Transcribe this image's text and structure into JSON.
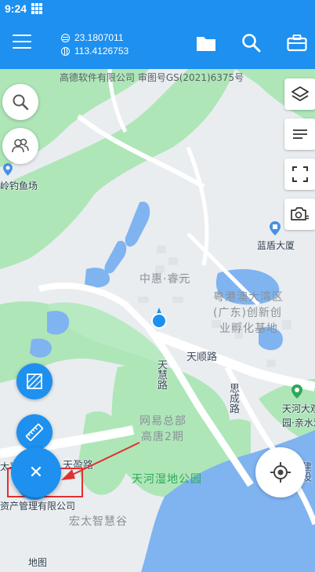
{
  "status_bar": {
    "time": "9:24"
  },
  "app_bar": {
    "latitude": "23.1807011",
    "longitude": "113.4126753",
    "icons": [
      "menu-icon",
      "folder-icon",
      "search-icon",
      "toolbox-icon"
    ]
  },
  "map": {
    "copyright": "高德软件有限公司 审图号GS(2021)6375号",
    "labels": {
      "fishing": "岭钓鱼场",
      "zhonghui": "中惠·睿元",
      "landun": "蓝盾大厦",
      "incubator_1": "粤港澳大湾区",
      "incubator_2": "(广东)创新创",
      "incubator_3": "业孵化基地",
      "tianshun": "天顺路",
      "tianhui": "天慧路",
      "sicheng": "思成路",
      "netease_1": "网易总部",
      "netease_2": "高唐2期",
      "tianhe_daguan_1": "天河大观湿",
      "tianhe_daguan_2": "园·亲水观",
      "tianying": "天盈路",
      "taiping": "太平洋网络",
      "company": "资产管理有限公司",
      "wetland_park": "天河湿地公园",
      "hongtai": "宏太智慧谷",
      "map_text": "地图",
      "jianshe": "建设"
    }
  },
  "colors": {
    "primary": "#1e90ef",
    "park": "#aee6b8",
    "water": "#7fb4f0",
    "annotation": "#e23030"
  }
}
